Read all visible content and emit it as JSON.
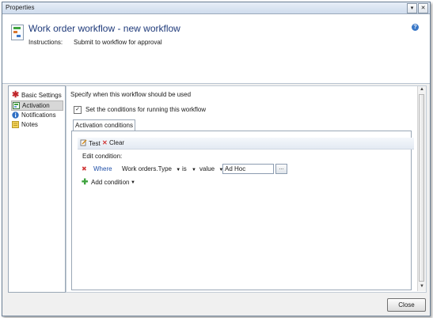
{
  "window": {
    "title": "Properties",
    "minimize_glyph": "▾",
    "close_glyph": "✕"
  },
  "header": {
    "title": "Work order workflow - new workflow",
    "instructions_label": "Instructions:",
    "instructions_value": "Submit to workflow for approval",
    "help_glyph": "?"
  },
  "nav": {
    "items": [
      {
        "label": "Basic Settings",
        "icon": "red-asterisk-icon"
      },
      {
        "label": "Activation",
        "icon": "activation-icon",
        "selected": true
      },
      {
        "label": "Notifications",
        "icon": "info-icon"
      },
      {
        "label": "Notes",
        "icon": "notes-icon"
      }
    ]
  },
  "content": {
    "heading": "Specify when this workflow should be used",
    "checkbox_label": "Set the conditions for running this workflow",
    "checkbox_checked": true,
    "checkbox_glyph": "✓",
    "tab_label": "Activation conditions",
    "toolbar": {
      "test_label": "Test",
      "clear_label": "Clear"
    },
    "edit_condition_label": "Edit condition:",
    "condition": {
      "remove_glyph": "✖",
      "where_label": "Where",
      "field": "Work orders.Type",
      "operator": "is",
      "value_type": "value",
      "value": "Ad Hoc",
      "browse_label": "..."
    },
    "add_condition_label": "Add condition",
    "dropdown_glyph": "▼"
  },
  "footer": {
    "close_label": "Close"
  },
  "colors": {
    "title_blue": "#1f3a7a",
    "link_blue": "#1f4fa8",
    "accent_green": "#3fa33f",
    "remove_red": "#d23a3a"
  }
}
